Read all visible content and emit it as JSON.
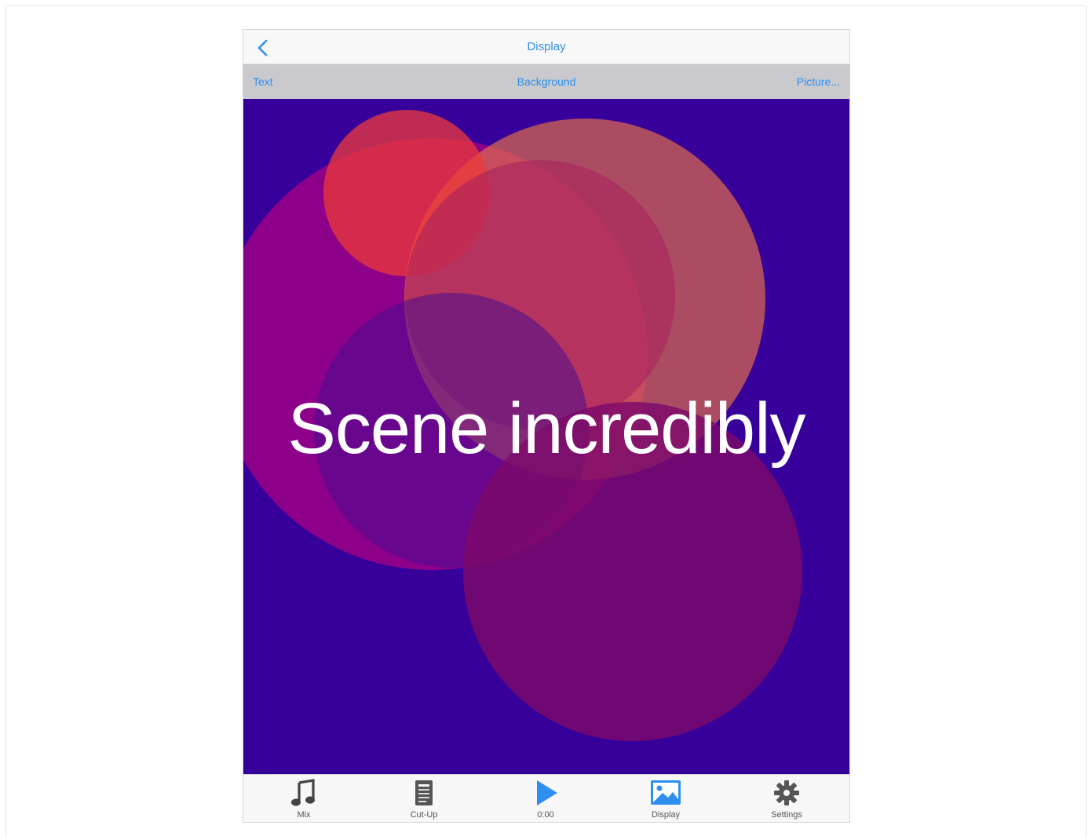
{
  "navbar": {
    "title": "Display",
    "back_icon": "chevron-left-icon"
  },
  "segments": {
    "text": "Text",
    "background": "Background",
    "picture": "Picture..."
  },
  "stage": {
    "background_color": "#38009a",
    "caption": "Scene incredibly"
  },
  "tabbar": {
    "tabs": [
      {
        "label": "Mix",
        "icon": "music-note-icon"
      },
      {
        "label": "Cut-Up",
        "icon": "document-icon"
      },
      {
        "label": "0:00",
        "icon": "play-icon"
      },
      {
        "label": "Display",
        "icon": "picture-icon"
      },
      {
        "label": "Settings",
        "icon": "gear-icon"
      }
    ]
  },
  "colors": {
    "accent": "#2f8ff0",
    "tab_inactive": "#555555"
  }
}
